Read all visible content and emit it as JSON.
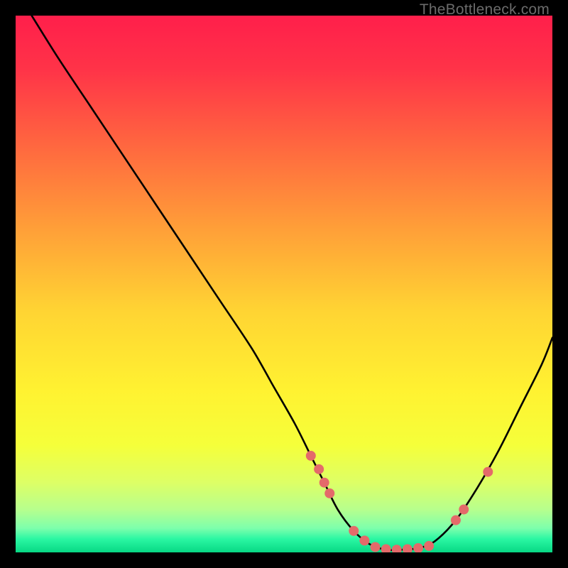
{
  "watermark": "TheBottleneck.com",
  "chart_data": {
    "type": "line",
    "title": "",
    "xlabel": "",
    "ylabel": "",
    "x_range": [
      0,
      100
    ],
    "y_range": [
      0,
      100
    ],
    "curve": {
      "name": "bottleneck-curve",
      "x": [
        3,
        8,
        14,
        20,
        26,
        32,
        38,
        44,
        48,
        52,
        55,
        57.5,
        60,
        63,
        66,
        69,
        72,
        75,
        78,
        82,
        86,
        90,
        94,
        98,
        100
      ],
      "y": [
        100,
        92,
        83,
        74,
        65,
        56,
        47,
        38,
        31,
        24,
        18,
        13,
        8,
        4,
        1.5,
        0.5,
        0.5,
        0.8,
        2,
        6,
        12,
        19,
        27,
        35,
        40
      ]
    },
    "markers": {
      "name": "highlight-points",
      "color": "#e46a6a",
      "x": [
        55,
        56.5,
        57.5,
        58.5,
        63,
        65,
        67,
        69,
        71,
        73,
        75,
        77,
        82,
        83.5,
        88
      ],
      "y": [
        18,
        15.5,
        13,
        11,
        4,
        2.2,
        1,
        0.6,
        0.5,
        0.6,
        0.8,
        1.2,
        6,
        8,
        15
      ]
    },
    "gradient_stops": [
      {
        "offset": 0.0,
        "color": "#ff1f4b"
      },
      {
        "offset": 0.1,
        "color": "#ff3348"
      },
      {
        "offset": 0.25,
        "color": "#ff6a3f"
      },
      {
        "offset": 0.4,
        "color": "#ffa038"
      },
      {
        "offset": 0.55,
        "color": "#ffd433"
      },
      {
        "offset": 0.7,
        "color": "#fff231"
      },
      {
        "offset": 0.8,
        "color": "#f5ff3a"
      },
      {
        "offset": 0.87,
        "color": "#ddff66"
      },
      {
        "offset": 0.92,
        "color": "#b7ff8d"
      },
      {
        "offset": 0.955,
        "color": "#7dffac"
      },
      {
        "offset": 0.975,
        "color": "#2bf7a3"
      },
      {
        "offset": 1.0,
        "color": "#07d884"
      }
    ]
  }
}
